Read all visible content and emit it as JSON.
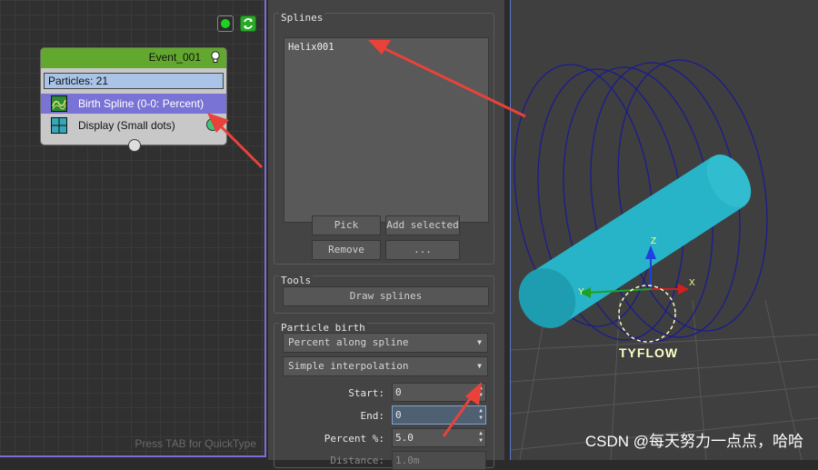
{
  "graph": {
    "event": {
      "title": "Event_001",
      "particles_label": "Particles: 21",
      "operators": [
        {
          "label": "Birth Spline (0-0: Percent)",
          "selected": true
        },
        {
          "label": "Display (Small dots)",
          "selected": false
        }
      ]
    },
    "quicktype_hint": "Press TAB for QuickType"
  },
  "panel": {
    "splines_group": {
      "title": "Splines",
      "items": [
        "Helix001"
      ],
      "buttons": {
        "pick": "Pick",
        "add_selected": "Add selected",
        "remove": "Remove",
        "more": "..."
      }
    },
    "tools_group": {
      "title": "Tools",
      "draw_splines": "Draw splines"
    },
    "particle_birth_group": {
      "title": "Particle birth",
      "mode_dropdown": "Percent along spline",
      "interpolation_dropdown": "Simple interpolation",
      "start_label": "Start:",
      "start_value": "0",
      "end_label": "End:",
      "end_value": "0",
      "percent_label": "Percent %:",
      "percent_value": "5.0",
      "distance_label": "Distance:",
      "distance_value": "1.0m"
    }
  },
  "viewport": {
    "gizmo_label": "TYFLOW",
    "axis_z": "Z",
    "axis_y": "Y",
    "axis_x": "X"
  },
  "watermark": "CSDN @每天努力一点点，哈哈",
  "colors": {
    "event_header": "#62a82e",
    "selected_operator": "#7a73d6",
    "helix": "#1c1c8c",
    "cylinder": "#27b4c8",
    "annotation_arrow": "#e8423a"
  }
}
